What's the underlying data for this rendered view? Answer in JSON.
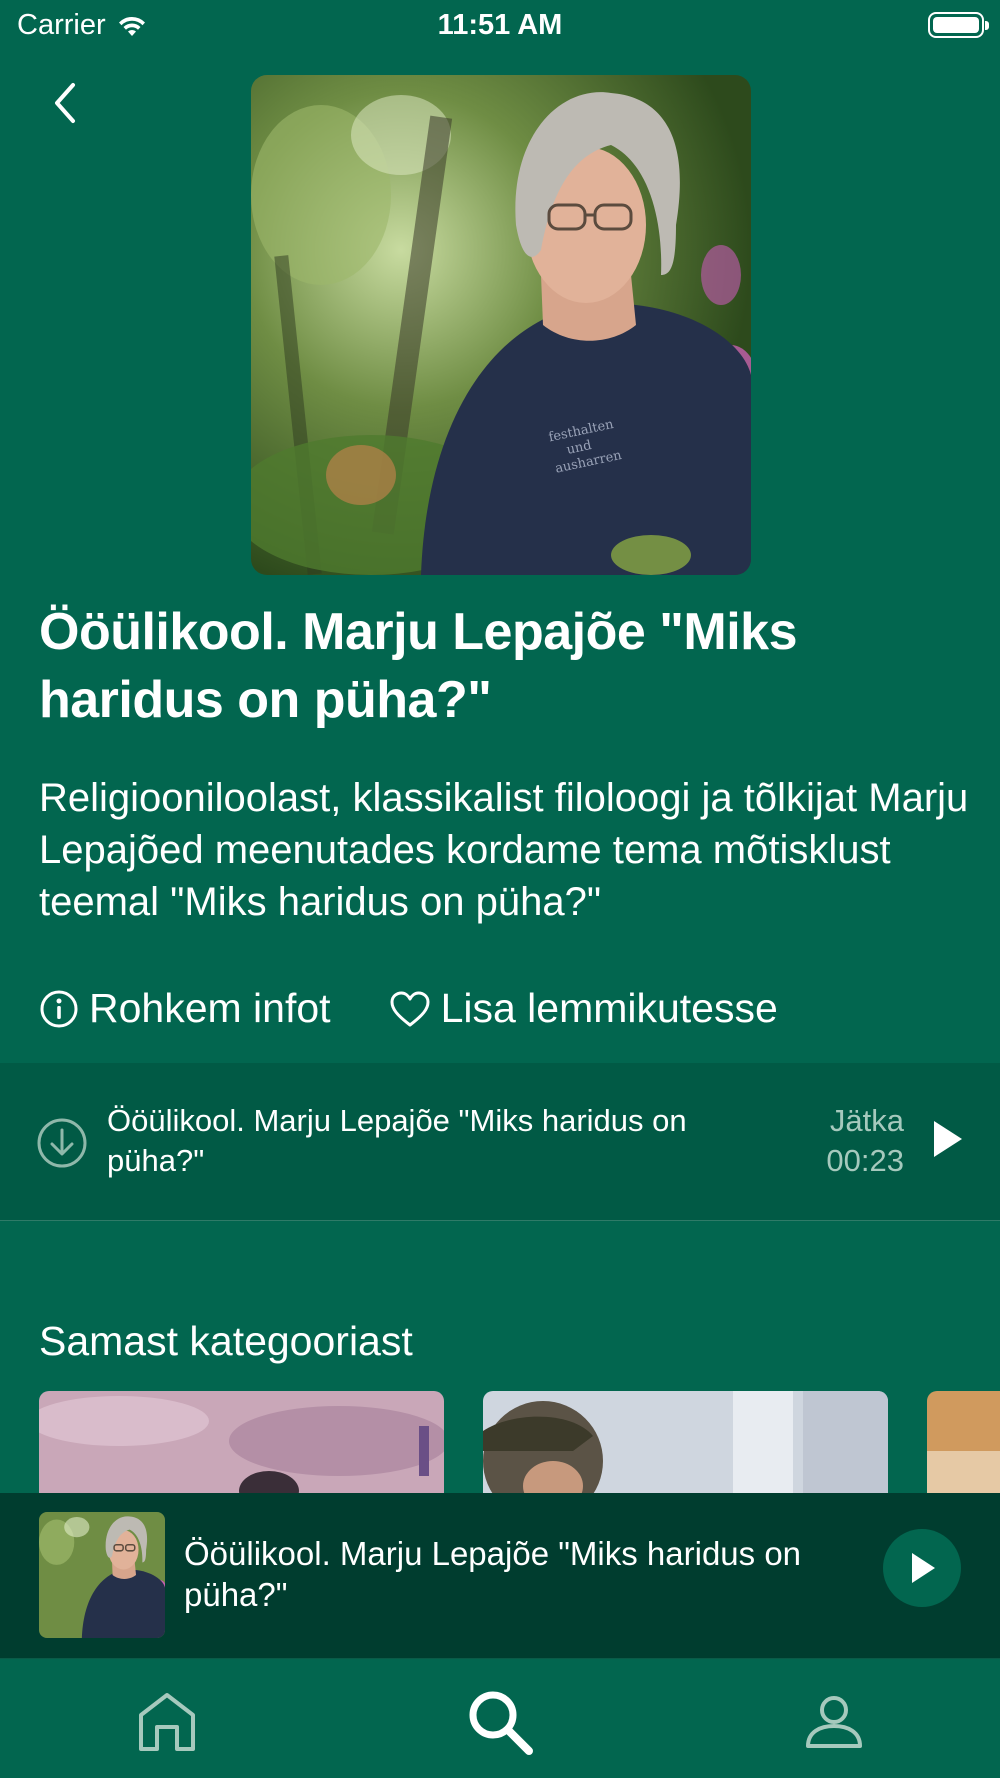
{
  "status_bar": {
    "carrier": "Carrier",
    "time": "11:51 AM"
  },
  "podcast": {
    "title": "Ööülikool. Marju Lepajõe \"Miks haridus on püha?\"",
    "description": "Religiooniloolast, klassikalist filoloogi ja tõlkijat Marju Lepajõed meenutades kordame tema mõtisklust teemal \"Miks haridus on püha?\"",
    "more_info_label": "Rohkem infot",
    "favorite_label": "Lisa lemmikutesse"
  },
  "episode": {
    "title": "Ööülikool. Marju Lepajõe \"Miks haridus on püha?\"",
    "resume_label": "Jätka",
    "resume_time": "00:23"
  },
  "related": {
    "title": "Samast kategooriast"
  },
  "mini_player": {
    "title": "Ööülikool. Marju Lepajõe \"Miks haridus on püha?\""
  },
  "tabs": [
    "home-icon",
    "search-icon",
    "profile-icon"
  ],
  "colors": {
    "background": "#02664f",
    "row": "#015a45",
    "player": "#003d2f",
    "muted": "#a6c9bd"
  }
}
